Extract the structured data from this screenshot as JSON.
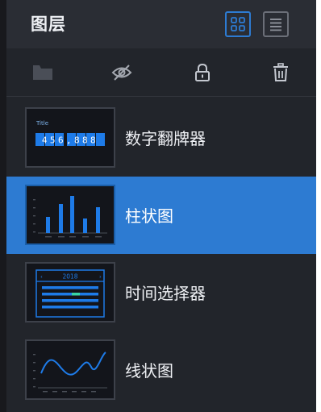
{
  "panel": {
    "title": "图层",
    "view_toggle": {
      "grid_icon": "grid-view-icon",
      "list_icon": "list-view-icon"
    }
  },
  "toolbar": {
    "icons": [
      "folder-icon",
      "eye-hidden-icon",
      "lock-icon",
      "trash-icon"
    ]
  },
  "layers": [
    {
      "label": "数字翻牌器",
      "thumb_title": "Title",
      "thumb_value": "456,888",
      "selected": false
    },
    {
      "label": "柱状图",
      "selected": true
    },
    {
      "label": "时间选择器",
      "thumb_year": "2018",
      "selected": false
    },
    {
      "label": "线状图",
      "selected": false
    }
  ],
  "colors": {
    "accent": "#2d7bd2",
    "panel_bg": "#22252b",
    "header_bg": "#2a2d34",
    "thumb_blue": "#1e7be8"
  }
}
